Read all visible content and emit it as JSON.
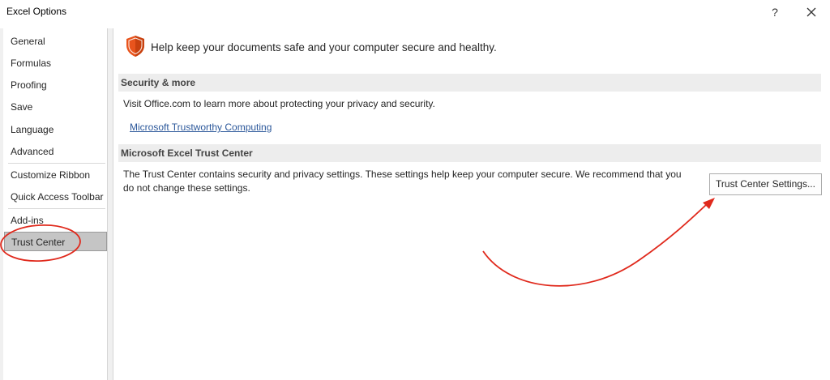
{
  "window": {
    "title": "Excel Options",
    "help_label": "?"
  },
  "sidebar": {
    "items": [
      {
        "label": "General"
      },
      {
        "label": "Formulas"
      },
      {
        "label": "Proofing"
      },
      {
        "label": "Save"
      },
      {
        "label": "Language"
      },
      {
        "label": "Advanced"
      },
      {
        "label": "Customize Ribbon"
      },
      {
        "label": "Quick Access Toolbar"
      },
      {
        "label": "Add-ins"
      },
      {
        "label": "Trust Center"
      }
    ],
    "selected": "Trust Center"
  },
  "main": {
    "headline": "Help keep your documents safe and your computer secure and healthy.",
    "security_section": {
      "header": "Security & more",
      "description": "Visit Office.com to learn more about protecting your privacy and security.",
      "link": "Microsoft Trustworthy Computing"
    },
    "trust_center_section": {
      "header": "Microsoft Excel Trust Center",
      "description_line1": "The Trust Center contains security and privacy settings. These settings help keep your computer secure. We recommend that you",
      "description_line2": "do not change these settings.",
      "button_label": "Trust Center Settings..."
    }
  },
  "colors": {
    "shield": "#e8541d",
    "link": "#2b579a",
    "selected_bg": "#c5c5c5",
    "section_bg": "#ededed",
    "annotation_red": "#e0291c"
  }
}
